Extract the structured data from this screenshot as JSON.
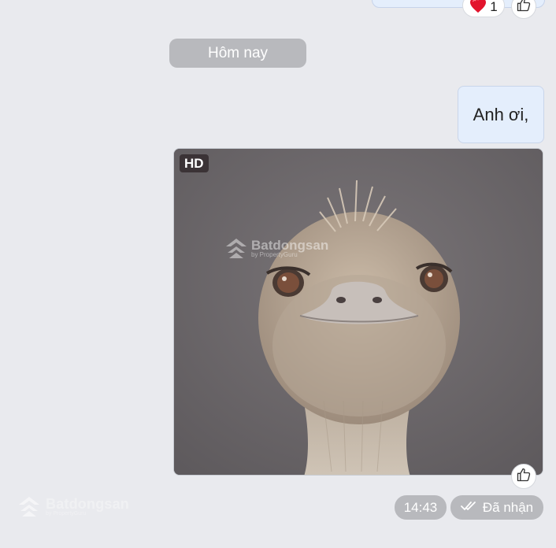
{
  "previous_message": {
    "reaction_emoji": "heart-icon",
    "reaction_count": "1"
  },
  "date_divider": "Hôm nay",
  "message_text": "Anh ơi,",
  "image_message": {
    "quality_badge": "HD",
    "watermark_brand": "Batdongsan",
    "watermark_sub": "by PropertyGuru"
  },
  "message_time": "14:43",
  "delivery_status": "Đã nhận",
  "corner_watermark": {
    "brand": "Batdongsan",
    "sub": "by PropertyGuru"
  },
  "colors": {
    "background": "#e9eaee",
    "my_bubble": "#e4eefc",
    "pill": "#b8b9bd"
  }
}
